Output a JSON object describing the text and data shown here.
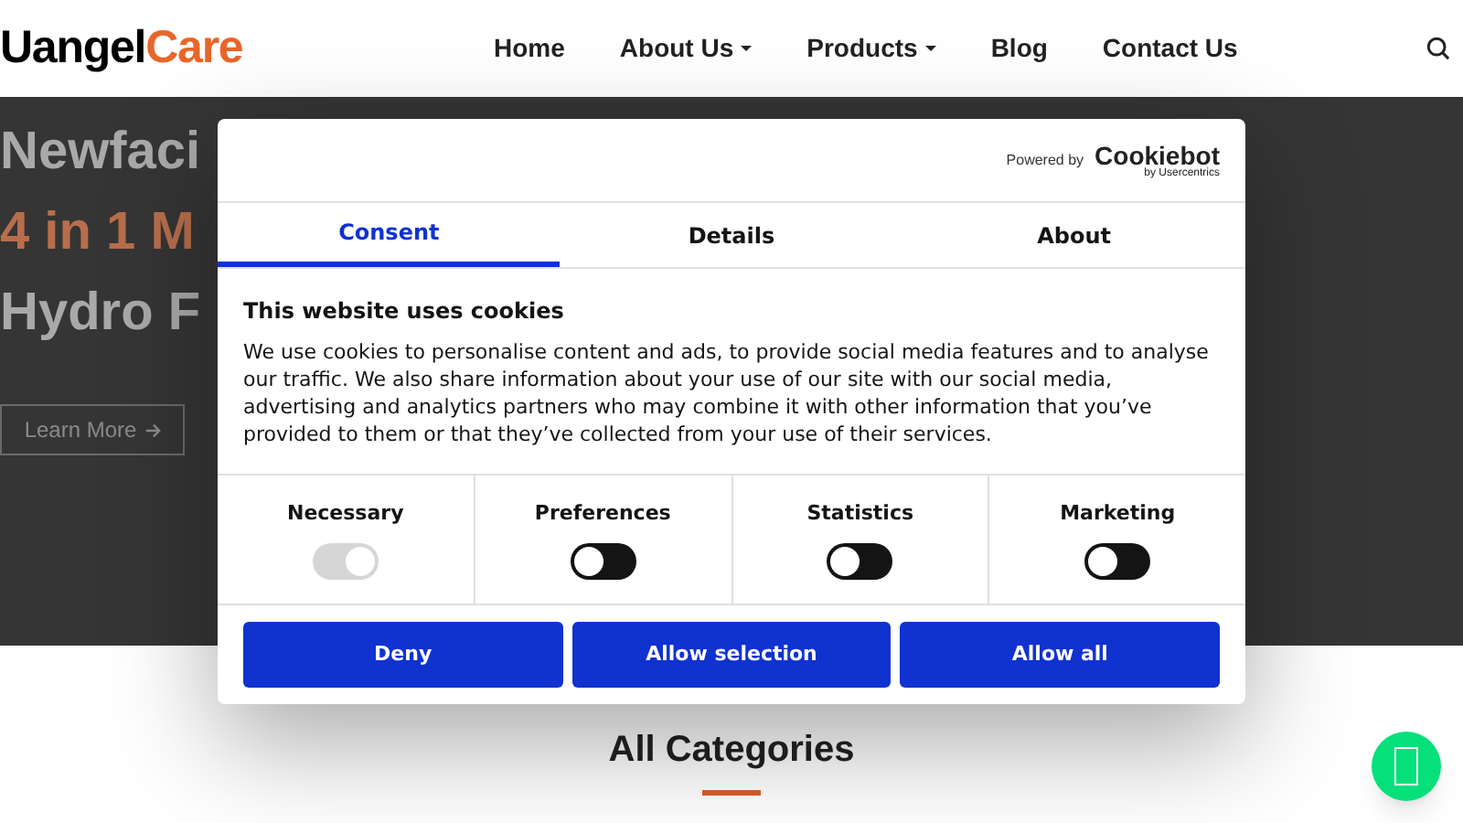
{
  "header": {
    "logo": {
      "part_1": "Uangel",
      "part_2": "Care"
    },
    "nav": [
      {
        "label": "Home",
        "dropdown": false
      },
      {
        "label": "About Us",
        "dropdown": true
      },
      {
        "label": "Products",
        "dropdown": true
      },
      {
        "label": "Blog",
        "dropdown": false
      },
      {
        "label": "Contact Us",
        "dropdown": false
      }
    ]
  },
  "hero": {
    "lines": [
      {
        "text": "Newfaci",
        "kind": "plain"
      },
      {
        "text": "4 in 1 M",
        "kind": "accent"
      },
      {
        "text": "Hydro F",
        "kind": "plain"
      }
    ],
    "button": "Learn More"
  },
  "cookie_dialog": {
    "powered_by": "Powered by",
    "brand": "Cookiebot",
    "brand_sub": "by Usercentrics",
    "tabs": [
      {
        "label": "Consent",
        "selected": true
      },
      {
        "label": "Details",
        "selected": false
      },
      {
        "label": "About",
        "selected": false
      }
    ],
    "heading": "This website uses cookies",
    "body": "We use cookies to personalise content and ads, to provide social media features and to analyse our traffic. We also share information about your use of our site with our social media, advertising and analytics partners who may combine it with other information that you’ve provided to them or that they’ve collected from your use of their services.",
    "categories": [
      {
        "label": "Necessary",
        "on": true,
        "disabled": true
      },
      {
        "label": "Preferences",
        "on": false,
        "disabled": false
      },
      {
        "label": "Statistics",
        "on": false,
        "disabled": false
      },
      {
        "label": "Marketing",
        "on": false,
        "disabled": false
      }
    ],
    "buttons": [
      "Deny",
      "Allow selection",
      "Allow all"
    ]
  },
  "section": {
    "title": "All Categories"
  }
}
